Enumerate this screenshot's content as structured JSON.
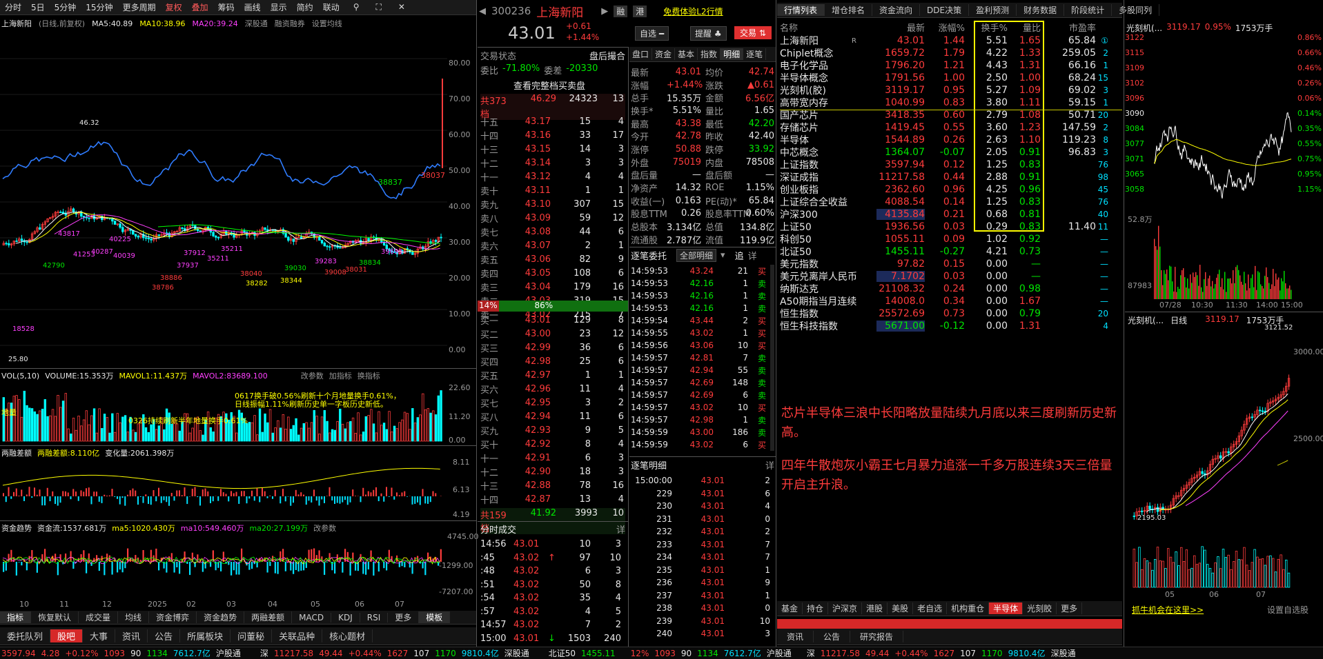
{
  "toolbar": {
    "items": [
      "分时",
      "5日",
      "5分钟",
      "15分钟",
      "更多周期",
      "复权",
      "叠加",
      "筹码",
      "画线",
      "显示",
      "简约",
      "联动"
    ],
    "window_icons": [
      "⚲",
      "⛶",
      "✕"
    ]
  },
  "chart": {
    "stock_name": "上海新阳",
    "adjust": "(日线,前复权)",
    "ma5": "MA5:40.89",
    "ma10": "MA10:38.96",
    "ma20": "MA20:39.24",
    "shenggu": "深股通",
    "rongzi": "融资融券",
    "setting": "设置均线",
    "price_axis": [
      "80.00",
      "70.00",
      "60.00",
      "50.00",
      "40.00",
      "30.00",
      "20.00",
      "10.00",
      "0.00"
    ],
    "annotations": [
      "46.32",
      "25.80",
      "18528",
      "38837",
      "38037",
      "43817",
      "42790",
      "41253",
      "40287",
      "40225",
      "40039",
      "37912",
      "37937",
      "38886",
      "38786",
      "38040",
      "38282",
      "38344",
      "39030",
      "39008",
      "38834",
      "38031",
      "39695",
      "39283",
      "35211",
      "35211"
    ],
    "vol_header": {
      "vol": "VOL(5,10)",
      "volume": "VOLUME:15.353万",
      "mavol1": "MAVOL1:11.437万",
      "mavol2": "MAVOL2:83689.100",
      "btn1": "改参数",
      "btn2": "加指标",
      "btn3": "换指标"
    },
    "vol_axis": [
      "22.60",
      "11.20",
      "0.00"
    ],
    "vol_note1": "0617换手破0.56%刷新十个月地量换手0.61%，",
    "vol_note2": "日线振幅1.11%刷新历史单一字板历史新低。",
    "vol_note3": "0326持续刷新半年地量换手0.61%",
    "vol_note4": "地量",
    "margin_header": {
      "name": "两融差额",
      "val": "两融差额:8.110亿",
      "chg": "变化量:2061.398万"
    },
    "margin_axis": [
      "8.11",
      "6.13",
      "4.19"
    ],
    "fund_header": {
      "name": "资金趋势",
      "flow": "资金流:1537.681万",
      "ma5": "ma5:1020.430万",
      "ma10": "ma10:549.460万",
      "ma20": "ma20:27.199万",
      "btn": "改参数"
    },
    "fund_axis": [
      "4745.00",
      "-1299.00",
      "-7207.00"
    ],
    "x_axis": [
      "10",
      "11",
      "12",
      "2025",
      "02",
      "03",
      "04",
      "05",
      "06",
      "07"
    ],
    "indicator_tabs": [
      "指标",
      "恢复默认",
      "成交量",
      "均线",
      "资金博弈",
      "资金趋势",
      "两融差额",
      "MACD",
      "KDJ",
      "RSI",
      "更多",
      "模板"
    ]
  },
  "bottom_tabs": [
    "委托队列",
    "股吧",
    "大事",
    "资讯",
    "公告",
    "所属板块",
    "问董秘",
    "关联品种",
    "核心题材"
  ],
  "stock": {
    "code": "300236",
    "name": "上海新阳",
    "price": "43.01",
    "change": "+0.61",
    "change_pct": "+1.44%",
    "tag1": "融",
    "tag2": "港",
    "promo": "免费体验L2行情",
    "btn_zixuan": "自选 ━",
    "btn_tixing": "提醒 ♣",
    "btn_jiaoyi": "交易 ⇅",
    "trade_state": "交易状态",
    "trade_state_val": "盘后撮合",
    "weibi": "委比",
    "weibi_val": "-71.80%",
    "weicha": "委差",
    "weicha_val": "-20330",
    "full_queue": "查看完整档买卖盘",
    "sell_total_label": "共373档",
    "sell_total_price": "46.29",
    "sell_total_vol": "24323",
    "sell_total_cnt": "13",
    "buy_total_label": "共159档",
    "buy_total_price": "41.92",
    "buy_total_vol": "3993",
    "buy_total_cnt": "10",
    "ratio_left": "14%",
    "ratio_right": "86%"
  },
  "asks": [
    {
      "l": "十五",
      "p": "43.17",
      "v": "15",
      "c": "4"
    },
    {
      "l": "十四",
      "p": "43.16",
      "v": "33",
      "c": "17"
    },
    {
      "l": "十三",
      "p": "43.15",
      "v": "14",
      "c": "3"
    },
    {
      "l": "十二",
      "p": "43.14",
      "v": "3",
      "c": "3"
    },
    {
      "l": "十一",
      "p": "43.12",
      "v": "4",
      "c": "4"
    },
    {
      "l": "卖十",
      "p": "43.11",
      "v": "1",
      "c": "1"
    },
    {
      "l": "卖九",
      "p": "43.10",
      "v": "307",
      "c": "15"
    },
    {
      "l": "卖八",
      "p": "43.09",
      "v": "59",
      "c": "12"
    },
    {
      "l": "卖七",
      "p": "43.08",
      "v": "44",
      "c": "6"
    },
    {
      "l": "卖六",
      "p": "43.07",
      "v": "2",
      "c": "1"
    },
    {
      "l": "卖五",
      "p": "43.06",
      "v": "82",
      "c": "9"
    },
    {
      "l": "卖四",
      "p": "43.05",
      "v": "108",
      "c": "6"
    },
    {
      "l": "卖三",
      "p": "43.04",
      "v": "179",
      "c": "16"
    },
    {
      "l": "卖二",
      "p": "43.03",
      "v": "319",
      "c": "15"
    },
    {
      "l": "卖一",
      "p": "43.02",
      "v": "215",
      "c": "7"
    }
  ],
  "bids": [
    {
      "l": "买一",
      "p": "43.01",
      "v": "129",
      "c": "8"
    },
    {
      "l": "买二",
      "p": "43.00",
      "v": "23",
      "c": "12"
    },
    {
      "l": "买三",
      "p": "42.99",
      "v": "36",
      "c": "6"
    },
    {
      "l": "买四",
      "p": "42.98",
      "v": "25",
      "c": "6"
    },
    {
      "l": "买五",
      "p": "42.97",
      "v": "1",
      "c": "1"
    },
    {
      "l": "买六",
      "p": "42.96",
      "v": "11",
      "c": "4"
    },
    {
      "l": "买七",
      "p": "42.95",
      "v": "3",
      "c": "2"
    },
    {
      "l": "买八",
      "p": "42.94",
      "v": "11",
      "c": "6"
    },
    {
      "l": "买九",
      "p": "42.93",
      "v": "9",
      "c": "5"
    },
    {
      "l": "买十",
      "p": "42.92",
      "v": "8",
      "c": "4"
    },
    {
      "l": "十一",
      "p": "42.91",
      "v": "6",
      "c": "3"
    },
    {
      "l": "十二",
      "p": "42.90",
      "v": "18",
      "c": "3"
    },
    {
      "l": "十三",
      "p": "42.88",
      "v": "78",
      "c": "16"
    },
    {
      "l": "十四",
      "p": "42.87",
      "v": "13",
      "c": "4"
    },
    {
      "l": "十五",
      "p": "42.86",
      "v": "5",
      "c": "1"
    }
  ],
  "quote_tabs": [
    "盘口",
    "资金",
    "基本",
    "指数",
    "明细",
    "逐笔"
  ],
  "quote": [
    [
      "最新",
      "43.01",
      "均价",
      "42.74"
    ],
    [
      "涨幅",
      "+1.44%",
      "涨跌",
      "▲0.61"
    ],
    [
      "总手",
      "15.35万",
      "金额",
      "6.56亿"
    ],
    [
      "换手*",
      "5.51%",
      "量比",
      "1.65"
    ],
    [
      "最高",
      "43.38",
      "最低",
      "42.20"
    ],
    [
      "今开",
      "42.78",
      "昨收",
      "42.40"
    ],
    [
      "涨停",
      "50.88",
      "跌停",
      "33.92"
    ],
    [
      "外盘",
      "75019",
      "内盘",
      "78508"
    ],
    [
      "盘后量",
      "—",
      "盘后额",
      "—"
    ],
    [
      "净资产",
      "14.32",
      "ROE",
      "1.15%"
    ],
    [
      "收益(一)",
      "0.163",
      "PE(动)*",
      "65.84"
    ],
    [
      "股息TTM",
      "0.26",
      "股息率TTM",
      "0.60%"
    ],
    [
      "总股本",
      "3.134亿",
      "总值",
      "134.8亿"
    ],
    [
      "流通股",
      "2.787亿",
      "流值",
      "119.9亿"
    ]
  ],
  "zhubi": {
    "title": "逐笔委托",
    "filter": "全部明细",
    "btn1": "追",
    "btn2": "详",
    "rows": [
      [
        "14:59:53",
        "43.24",
        "21",
        "买"
      ],
      [
        "14:59:53",
        "42.16",
        "1",
        "卖"
      ],
      [
        "14:59:53",
        "42.16",
        "1",
        "卖"
      ],
      [
        "14:59:53",
        "42.16",
        "1",
        "卖"
      ],
      [
        "14:59:54",
        "43.44",
        "2",
        "买"
      ],
      [
        "14:59:55",
        "43.02",
        "1",
        "买"
      ],
      [
        "14:59:56",
        "43.06",
        "10",
        "买"
      ],
      [
        "14:59:57",
        "42.81",
        "7",
        "卖"
      ],
      [
        "14:59:57",
        "42.94",
        "55",
        "卖"
      ],
      [
        "14:59:57",
        "42.69",
        "148",
        "卖"
      ],
      [
        "14:59:57",
        "42.69",
        "6",
        "卖"
      ],
      [
        "14:59:57",
        "43.02",
        "10",
        "买"
      ],
      [
        "14:59:57",
        "42.98",
        "1",
        "卖"
      ],
      [
        "14:59:59",
        "43.00",
        "186",
        "卖"
      ],
      [
        "14:59:59",
        "43.02",
        "6",
        "买"
      ]
    ]
  },
  "fenshi": {
    "title": "分时成交",
    "btn": "详",
    "rows": [
      [
        "14:56",
        "43.01",
        "",
        "10",
        "3"
      ],
      [
        ":45",
        "43.02",
        "↑",
        "97",
        "10"
      ],
      [
        ":48",
        "43.02",
        "",
        "6",
        "3"
      ],
      [
        ":51",
        "43.02",
        "",
        "50",
        "8"
      ],
      [
        ":54",
        "43.02",
        "",
        "35",
        "4"
      ],
      [
        ":57",
        "43.02",
        "",
        "4",
        "5"
      ],
      [
        "14:57",
        "43.02",
        "",
        "7",
        "2"
      ],
      [
        "15:00",
        "43.01",
        "↓",
        "1503",
        "240"
      ]
    ]
  },
  "mingxi": {
    "title": "逐笔明细",
    "btn": "详",
    "rows": [
      [
        "15:00:00",
        "43.01",
        "2"
      ],
      [
        "229",
        "43.01",
        "6"
      ],
      [
        "230",
        "43.01",
        "4"
      ],
      [
        "231",
        "43.01",
        "0"
      ],
      [
        "232",
        "43.01",
        "2"
      ],
      [
        "233",
        "43.01",
        "7"
      ],
      [
        "234",
        "43.01",
        "7"
      ],
      [
        "235",
        "43.01",
        "1"
      ],
      [
        "236",
        "43.01",
        "9"
      ],
      [
        "237",
        "43.01",
        "1"
      ],
      [
        "238",
        "43.01",
        "0"
      ],
      [
        "239",
        "43.01",
        "10"
      ],
      [
        "240",
        "43.01",
        "3"
      ]
    ]
  },
  "right_tabs": [
    "行情列表",
    "增仓排名",
    "资金流向",
    "DDE决策",
    "盈利预测",
    "财务数据",
    "阶段统计",
    "多股同列"
  ],
  "table_headers": [
    "名称",
    "最新",
    "涨幅%",
    "换手%",
    "量比",
    "市盈率"
  ],
  "table_rows": [
    {
      "n": "上海新阳",
      "b": "R",
      "p": "43.01",
      "c": "1.44",
      "t": "5.51",
      "v": "1.65",
      "pe": "65.84",
      "x": "①",
      "col": "r"
    },
    {
      "n": "Chiplet概念",
      "p": "1659.72",
      "c": "1.79",
      "t": "4.22",
      "v": "1.33",
      "pe": "259.05",
      "x": "2",
      "col": "r"
    },
    {
      "n": "电子化学品",
      "p": "1796.20",
      "c": "1.21",
      "t": "4.43",
      "v": "1.31",
      "pe": "66.16",
      "x": "1",
      "col": "r"
    },
    {
      "n": "半导体概念",
      "p": "1791.56",
      "c": "1.00",
      "t": "2.50",
      "v": "1.00",
      "pe": "68.24",
      "x": "15",
      "col": "r"
    },
    {
      "n": "光刻机(胶)",
      "p": "3119.17",
      "c": "0.95",
      "t": "5.27",
      "v": "1.09",
      "pe": "69.02",
      "x": "3",
      "col": "r"
    },
    {
      "n": "高带宽内存",
      "p": "1040.99",
      "c": "0.83",
      "t": "3.80",
      "v": "1.11",
      "pe": "59.15",
      "x": "1",
      "col": "r"
    },
    {
      "n": "国产芯片",
      "p": "3418.35",
      "c": "0.60",
      "t": "2.79",
      "v": "1.08",
      "pe": "50.71",
      "x": "20",
      "col": "r"
    },
    {
      "n": "存储芯片",
      "p": "1419.45",
      "c": "0.55",
      "t": "3.60",
      "v": "1.23",
      "pe": "147.59",
      "x": "2",
      "col": "r"
    },
    {
      "n": "半导体",
      "p": "1544.89",
      "c": "0.26",
      "t": "2.63",
      "v": "1.10",
      "pe": "119.23",
      "x": "8",
      "col": "r"
    },
    {
      "n": "中芯概念",
      "p": "1364.07",
      "c": "-0.07",
      "t": "2.05",
      "v": "0.91",
      "pe": "96.83",
      "x": "3",
      "col": "g"
    },
    {
      "n": "上证指数",
      "p": "3597.94",
      "c": "0.12",
      "t": "1.25",
      "v": "0.83",
      "pe": "",
      "x": "76",
      "col": "r"
    },
    {
      "n": "深证成指",
      "p": "11217.58",
      "c": "0.44",
      "t": "2.88",
      "v": "0.91",
      "pe": "",
      "x": "98",
      "col": "r"
    },
    {
      "n": "创业板指",
      "p": "2362.60",
      "c": "0.96",
      "t": "4.25",
      "v": "0.96",
      "pe": "",
      "x": "45",
      "col": "r"
    },
    {
      "n": "上证综合全收益",
      "p": "4088.54",
      "c": "0.14",
      "t": "1.25",
      "v": "0.83",
      "pe": "",
      "x": "76",
      "col": "r"
    },
    {
      "n": "沪深300",
      "p": "4135.84",
      "c": "0.21",
      "t": "0.68",
      "v": "0.81",
      "pe": "",
      "x": "40",
      "col": "r",
      "hl": true
    },
    {
      "n": "上证50",
      "p": "1936.56",
      "c": "0.03",
      "t": "0.29",
      "v": "0.83",
      "pe": "11.40",
      "x": "11",
      "col": "r"
    },
    {
      "n": "科创50",
      "p": "1055.11",
      "c": "0.09",
      "t": "1.02",
      "v": "0.92",
      "pe": "",
      "x": "—",
      "col": "r"
    },
    {
      "n": "北证50",
      "p": "1455.11",
      "c": "-0.27",
      "t": "4.21",
      "v": "0.73",
      "pe": "",
      "x": "—",
      "col": "g"
    },
    {
      "n": "美元指数",
      "p": "97.82",
      "c": "0.15",
      "t": "0.00",
      "v": "—",
      "pe": "",
      "x": "—",
      "col": "r"
    },
    {
      "n": "美元兑离岸人民币",
      "p": "7.1702",
      "c": "0.03",
      "t": "0.00",
      "v": "—",
      "pe": "",
      "x": "—",
      "col": "r",
      "hl": true
    },
    {
      "n": "纳斯达克",
      "p": "21108.32",
      "c": "0.24",
      "t": "0.00",
      "v": "0.98",
      "pe": "",
      "x": "—",
      "col": "r"
    },
    {
      "n": "A50期指当月连续",
      "p": "14008.0",
      "c": "0.34",
      "t": "0.00",
      "v": "1.67",
      "pe": "",
      "x": "—",
      "col": "r"
    },
    {
      "n": "恒生指数",
      "p": "25572.69",
      "c": "0.73",
      "t": "0.00",
      "v": "0.79",
      "pe": "",
      "x": "20",
      "col": "r"
    },
    {
      "n": "恒生科技指数",
      "p": "5671.00",
      "c": "-0.12",
      "t": "0.00",
      "v": "1.31",
      "pe": "",
      "x": "4",
      "col": "g",
      "hl": true
    }
  ],
  "notes": [
    "芯片半导体三浪中长阳略放量陆续九月底以来三度刷新历史新高。",
    "四年牛散炮灰小霸王七月暴力追涨一千多万股连续3天三倍量开启主升浪。"
  ],
  "right_bottom_tabs": [
    "基金",
    "持仓",
    "沪深京",
    "港股",
    "美股",
    "老自选",
    "机构重仓",
    "半导体",
    "光刻胶",
    "更多"
  ],
  "promo_link": "抓牛机会在这里>>",
  "settings_link": "设置自选股",
  "news_tabs": [
    "资讯",
    "公告",
    "研究报告"
  ],
  "mini1": {
    "title": "光刻机(...",
    "price": "3119.17",
    "pct": "0.95%",
    "vol": "1753万手",
    "axis": [
      "3122",
      "3115",
      "3109",
      "3102",
      "3096",
      "3090",
      "3084",
      "3077",
      "3071",
      "3065",
      "3058"
    ],
    "axis_right": [
      "0.86%",
      "0.66%",
      "0.46%",
      "0.26%",
      "0.06%",
      "0.14%",
      "0.35%",
      "0.55%",
      "0.75%",
      "0.95%",
      "1.15%"
    ],
    "vol_axis": [
      "52.8万",
      "87983"
    ],
    "times": [
      "07/28",
      "10:30",
      "11:30",
      "14:00",
      "15:00"
    ]
  },
  "mini2": {
    "title": "光刻机(...",
    "period": "日线",
    "price": "3119.17",
    "vol": "1753万手",
    "high": "3121.52",
    "low": "2195.03",
    "axis": [
      "3000.00",
      "2500.00"
    ],
    "times": [
      "05",
      "06",
      "07"
    ]
  },
  "status": {
    "sh_val": "3597.94",
    "sh_chg": "4.28",
    "sh_pct": "+0.12%",
    "sh_a": "1093",
    "sh_b": "90",
    "sh_c": "1134",
    "sh_amt": "7612.7亿",
    "hgt": "沪股通",
    "sz": "深",
    "sz_val": "11217.58",
    "sz_chg": "49.44",
    "sz_pct": "+0.44%",
    "sz_a": "1627",
    "sz_b": "107",
    "sz_c": "1170",
    "sz_amt": "9810.4亿",
    "sgt": "深股通",
    "bz": "北证50",
    "bz_val": "1455.11",
    "r_pct": "12%",
    "r_a": "1093",
    "r_b": "90",
    "r_c": "1134",
    "r_amt": "7612.7亿",
    "r_hgt": "沪股通",
    "r_sz": "深",
    "r_val": "11217.58",
    "r_chg": "49.44",
    "r_pct2": "+0.44%",
    "r_x": "1627",
    "r_y": "107",
    "r_z": "1170",
    "r_amt2": "9810.4亿",
    "r_sgt": "深股通"
  },
  "colors": {
    "up": "#ff3c3c",
    "down": "#00e600",
    "yellow": "#ffff00",
    "accent": "#d62828"
  }
}
